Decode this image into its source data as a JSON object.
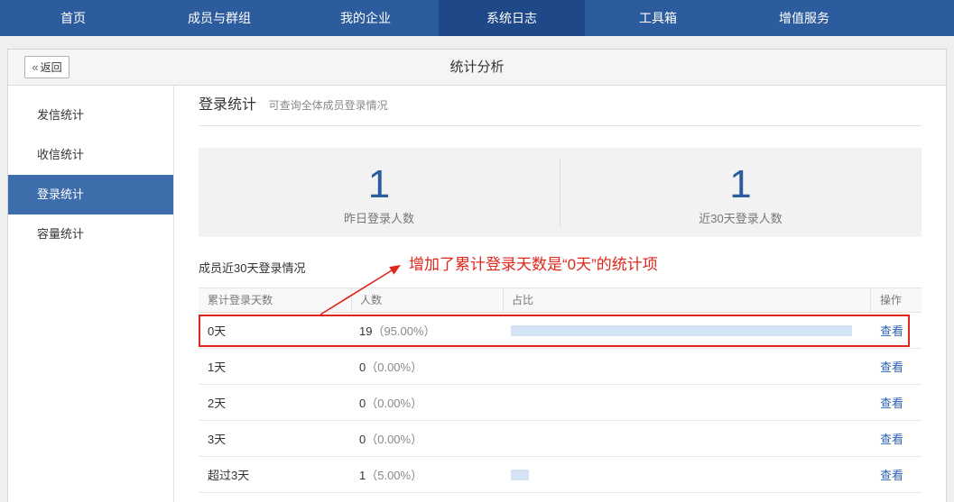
{
  "colors": {
    "nav_bg": "#2d5c9e",
    "nav_active_bg": "#1e4888",
    "sidebar_active_bg": "#3d6dab",
    "stat_number": "#2d5c9e",
    "link": "#2b63b1",
    "ratio_bar": "#d4e4f4",
    "annotation": "#e0251b"
  },
  "nav": {
    "items": [
      {
        "label": "首页",
        "active": false
      },
      {
        "label": "成员与群组",
        "active": false
      },
      {
        "label": "我的企业",
        "active": false
      },
      {
        "label": "系统日志",
        "active": true
      },
      {
        "label": "工具箱",
        "active": false
      },
      {
        "label": "增值服务",
        "active": false
      }
    ]
  },
  "header": {
    "back_icon": "double-chevron-left-icon",
    "back_label": "返回",
    "title": "统计分析"
  },
  "sidebar": {
    "items": [
      {
        "label": "发信统计",
        "active": false
      },
      {
        "label": "收信统计",
        "active": false
      },
      {
        "label": "登录统计",
        "active": true
      },
      {
        "label": "容量统计",
        "active": false
      }
    ]
  },
  "section": {
    "title": "登录统计",
    "subtitle": "可查询全体成员登录情况"
  },
  "stats": [
    {
      "value": "1",
      "label": "昨日登录人数"
    },
    {
      "value": "1",
      "label": "近30天登录人数"
    }
  ],
  "table": {
    "title": "成员近30天登录情况",
    "headers": [
      "累计登录天数",
      "人数",
      "占比",
      "操作"
    ],
    "rows": [
      {
        "days": "0天",
        "count": "19",
        "percent": "（95.00%）",
        "ratio": 0.95,
        "action": "查看"
      },
      {
        "days": "1天",
        "count": "0",
        "percent": "（0.00%）",
        "ratio": 0,
        "action": "查看"
      },
      {
        "days": "2天",
        "count": "0",
        "percent": "（0.00%）",
        "ratio": 0,
        "action": "查看"
      },
      {
        "days": "3天",
        "count": "0",
        "percent": "（0.00%）",
        "ratio": 0,
        "action": "查看"
      },
      {
        "days": "超过3天",
        "count": "1",
        "percent": "（5.00%）",
        "ratio": 0.05,
        "action": "查看"
      }
    ]
  },
  "annotation": {
    "text": "增加了累计登录天数是“0天”的统计项"
  }
}
